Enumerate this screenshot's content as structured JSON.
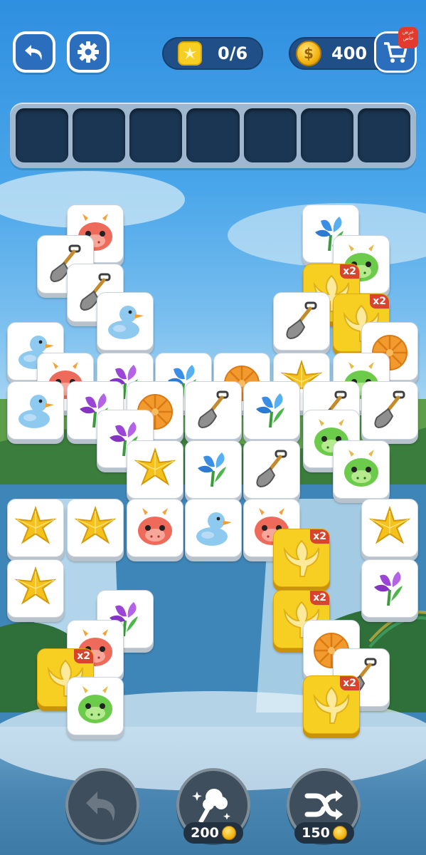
{
  "header": {
    "back_icon": "undo-arrow-icon",
    "settings_icon": "gear-icon",
    "goal_count": "0/6",
    "goal_icon": "golden-leaf-tile-icon",
    "coins": "400",
    "shop_icon": "cart-icon",
    "shop_badge": "عرض خاص"
  },
  "tray": {
    "slots": 7
  },
  "tiles": [
    {
      "kind": "dragon-red"
    },
    {
      "kind": "shovel"
    },
    {
      "kind": "flower"
    },
    {
      "kind": "dragon-green"
    },
    {
      "kind": "leaf-gold",
      "badge": "x2"
    },
    {
      "kind": "shovel"
    },
    {
      "kind": "duck"
    },
    {
      "kind": "leaf-gold",
      "badge": "x2"
    },
    {
      "kind": "duck"
    },
    {
      "kind": "shovel"
    },
    {
      "kind": "bun"
    },
    {
      "kind": "dragon-red"
    },
    {
      "kind": "flower-purple"
    },
    {
      "kind": "flower"
    },
    {
      "kind": "bun"
    },
    {
      "kind": "star"
    },
    {
      "kind": "dragon-green"
    },
    {
      "kind": "duck"
    },
    {
      "kind": "flower-purple"
    },
    {
      "kind": "bun"
    },
    {
      "kind": "shovel"
    },
    {
      "kind": "flower"
    },
    {
      "kind": "shovel"
    },
    {
      "kind": "shovel"
    },
    {
      "kind": "flower-purple"
    },
    {
      "kind": "star"
    },
    {
      "kind": "flower"
    },
    {
      "kind": "shovel"
    },
    {
      "kind": "dragon-green"
    },
    {
      "kind": "dragon-green"
    },
    {
      "kind": "star"
    },
    {
      "kind": "dragon-red"
    },
    {
      "kind": "duck"
    },
    {
      "kind": "dragon-red"
    },
    {
      "kind": "star"
    },
    {
      "kind": "star"
    },
    {
      "kind": "leaf-gold",
      "badge": "x2"
    },
    {
      "kind": "flower-purple"
    },
    {
      "kind": "star"
    },
    {
      "kind": "flower-purple"
    },
    {
      "kind": "leaf-gold",
      "badge": "x2"
    },
    {
      "kind": "dragon-red"
    },
    {
      "kind": "bun"
    },
    {
      "kind": "leaf-gold",
      "badge": "x2"
    },
    {
      "kind": "shovel"
    },
    {
      "kind": "leaf-gold",
      "badge": "x2"
    },
    {
      "kind": "dragon-green"
    }
  ],
  "boosters": [
    {
      "name": "undo",
      "icon": "undo-arrow-icon",
      "price": ""
    },
    {
      "name": "magic-wand",
      "icon": "magic-wand-icon",
      "price": "200"
    },
    {
      "name": "shuffle",
      "icon": "shuffle-icon",
      "price": "150"
    }
  ],
  "colors": {
    "sky": "#2f8fe0",
    "button_blue": "#2a6ebd",
    "tray_slot": "#1b3652",
    "tile_gold": "#f7cf22",
    "badge_red": "#d8452e"
  }
}
